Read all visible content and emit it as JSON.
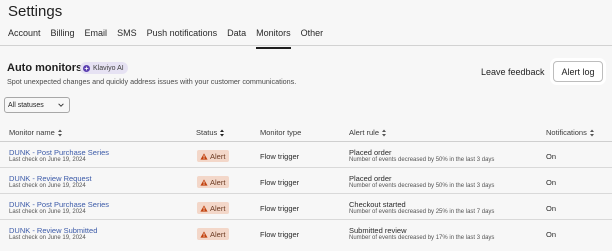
{
  "page": {
    "title": "Settings"
  },
  "tabs": [
    {
      "label": "Account",
      "active": false
    },
    {
      "label": "Billing",
      "active": false
    },
    {
      "label": "Email",
      "active": false
    },
    {
      "label": "SMS",
      "active": false
    },
    {
      "label": "Push notifications",
      "active": false
    },
    {
      "label": "Data",
      "active": false
    },
    {
      "label": "Monitors",
      "active": true
    },
    {
      "label": "Other",
      "active": false
    }
  ],
  "section": {
    "title": "Auto monitors",
    "badge": "Klaviyo AI",
    "subtitle": "Spot unexpected changes and quickly address issues with your customer communications.",
    "feedback_label": "Leave feedback",
    "alert_log_label": "Alert log"
  },
  "filter": {
    "selected": "All statuses"
  },
  "table": {
    "headers": {
      "name": "Monitor name",
      "status": "Status",
      "type": "Monitor type",
      "rule": "Alert rule",
      "notifications": "Notifications"
    },
    "rows": [
      {
        "name": "DUNK - Post Purchase Series",
        "last_check": "Last check on June 19, 2024",
        "status": "Alert",
        "type": "Flow trigger",
        "rule": "Placed order",
        "rule_desc": "Number of events decreased by 50% in the last 3 days",
        "notifications": "On"
      },
      {
        "name": "DUNK - Review Request",
        "last_check": "Last check on June 19, 2024",
        "status": "Alert",
        "type": "Flow trigger",
        "rule": "Placed order",
        "rule_desc": "Number of events decreased by 50% in the last 3 days",
        "notifications": "On"
      },
      {
        "name": "DUNK - Post Purchase Series",
        "last_check": "Last check on June 19, 2024",
        "status": "Alert",
        "type": "Flow trigger",
        "rule": "Checkout started",
        "rule_desc": "Number of events decreased by 25% in the last 7 days",
        "notifications": "On"
      },
      {
        "name": "DUNK - Review Submitted",
        "last_check": "Last check on June 19, 2024",
        "status": "Alert",
        "type": "Flow trigger",
        "rule": "Submitted review",
        "rule_desc": "Number of events decreased by 17% in the last 3 days",
        "notifications": "On"
      }
    ]
  },
  "colors": {
    "link": "#3b5aa8",
    "alert_bg": "#f3d7c9",
    "ai_purple": "#5b3fb0"
  },
  "icons": {
    "ai": "sparkle-icon",
    "sort": "sort-icon",
    "status_sort": "sort-desc-icon",
    "alert": "warning-icon",
    "select": "chevron-down-icon"
  }
}
